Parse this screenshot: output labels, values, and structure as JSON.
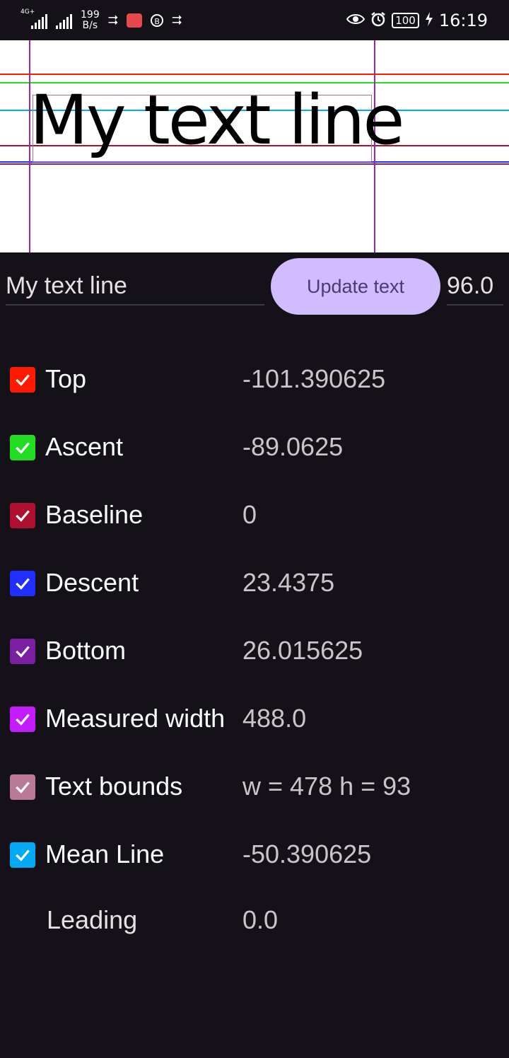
{
  "status_bar": {
    "network_label": "4G+",
    "speed_value": "199",
    "speed_unit": "B/s",
    "battery": "100",
    "time": "16:19",
    "icons": [
      "signal-icon",
      "signal-icon",
      "usb-icon",
      "app-notification-icon",
      "b-circle-icon",
      "usb-icon",
      "eye-icon",
      "alarm-icon",
      "battery-icon",
      "charging-icon"
    ]
  },
  "preview": {
    "sample_text": "My text line",
    "line_colors": {
      "top": "#ff1a00",
      "ascent": "#22dd22",
      "mean_line": "#03a9f4",
      "baseline": "#b01030",
      "descent": "#1e2fff",
      "bottom": "#7b1fa2",
      "measured_width": "#9c27b0",
      "text_bounds": "#b07090"
    }
  },
  "controls": {
    "text_value": "My text line",
    "update_button": "Update text",
    "size_value": "96.0"
  },
  "metrics": [
    {
      "label": "Top",
      "value": "-101.390625",
      "checked": true,
      "color": "#ff1a00"
    },
    {
      "label": "Ascent",
      "value": "-89.0625",
      "checked": true,
      "color": "#22dd22"
    },
    {
      "label": "Baseline",
      "value": "0",
      "checked": true,
      "color": "#b01030"
    },
    {
      "label": "Descent",
      "value": "23.4375",
      "checked": true,
      "color": "#1e2fff"
    },
    {
      "label": "Bottom",
      "value": "26.015625",
      "checked": true,
      "color": "#7b1fa2"
    },
    {
      "label": "Measured width",
      "value": "488.0",
      "checked": true,
      "color": "#c41bff"
    },
    {
      "label": "Text bounds",
      "value": "w = 478 h = 93",
      "checked": true,
      "color": "#b87a96"
    },
    {
      "label": "Mean Line",
      "value": "-50.390625",
      "checked": true,
      "color": "#03a9f4"
    },
    {
      "label": "Leading",
      "value": "0.0",
      "checked": false,
      "color": ""
    }
  ]
}
